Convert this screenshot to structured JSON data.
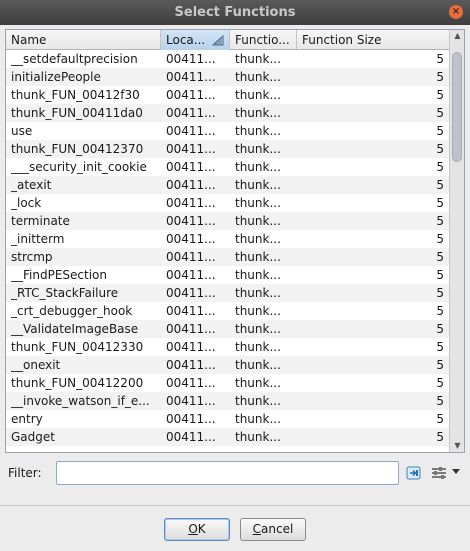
{
  "window": {
    "title": "Select Functions",
    "close_glyph": "×"
  },
  "table": {
    "columns": [
      {
        "label": "Name"
      },
      {
        "label": "Loca..."
      },
      {
        "label": "Functio..."
      },
      {
        "label": "Function Size"
      }
    ],
    "sorted_column": 1,
    "rows": [
      {
        "name": "__setdefaultprecision",
        "location": "00411...",
        "signature": "thunk...",
        "size": "5"
      },
      {
        "name": "initializePeople",
        "location": "00411...",
        "signature": "thunk...",
        "size": "5"
      },
      {
        "name": "thunk_FUN_00412f30",
        "location": "00411...",
        "signature": "thunk...",
        "size": "5"
      },
      {
        "name": "thunk_FUN_00411da0",
        "location": "00411...",
        "signature": "thunk...",
        "size": "5"
      },
      {
        "name": "use",
        "location": "00411...",
        "signature": "thunk...",
        "size": "5"
      },
      {
        "name": "thunk_FUN_00412370",
        "location": "00411...",
        "signature": "thunk...",
        "size": "5"
      },
      {
        "name": "___security_init_cookie",
        "location": "00411...",
        "signature": "thunk...",
        "size": "5"
      },
      {
        "name": "_atexit",
        "location": "00411...",
        "signature": "thunk...",
        "size": "5"
      },
      {
        "name": "_lock",
        "location": "00411...",
        "signature": "thunk...",
        "size": "5"
      },
      {
        "name": "terminate",
        "location": "00411...",
        "signature": "thunk...",
        "size": "5"
      },
      {
        "name": "_initterm",
        "location": "00411...",
        "signature": "thunk...",
        "size": "5"
      },
      {
        "name": "strcmp",
        "location": "00411...",
        "signature": "thunk...",
        "size": "5"
      },
      {
        "name": "__FindPESection",
        "location": "00411...",
        "signature": "thunk...",
        "size": "5"
      },
      {
        "name": "_RTC_StackFailure",
        "location": "00411...",
        "signature": "thunk...",
        "size": "5"
      },
      {
        "name": "_crt_debugger_hook",
        "location": "00411...",
        "signature": "thunk...",
        "size": "5"
      },
      {
        "name": "__ValidateImageBase",
        "location": "00411...",
        "signature": "thunk...",
        "size": "5"
      },
      {
        "name": "thunk_FUN_00412330",
        "location": "00411...",
        "signature": "thunk...",
        "size": "5"
      },
      {
        "name": "__onexit",
        "location": "00411...",
        "signature": "thunk...",
        "size": "5"
      },
      {
        "name": "thunk_FUN_00412200",
        "location": "00411...",
        "signature": "thunk...",
        "size": "5"
      },
      {
        "name": "__invoke_watson_if_e...",
        "location": "00411...",
        "signature": "thunk...",
        "size": "5"
      },
      {
        "name": "entry",
        "location": "00411...",
        "signature": "thunk...",
        "size": "5"
      },
      {
        "name": "Gadget",
        "location": "00411...",
        "signature": "thunk...",
        "size": "5"
      },
      {
        "name": "",
        "location": "",
        "signature": "",
        "size": ""
      }
    ]
  },
  "filter": {
    "label": "Filter:",
    "value": "",
    "placeholder": ""
  },
  "buttons": {
    "ok": {
      "mnemonic": "O",
      "rest": "K"
    },
    "cancel": {
      "mnemonic": "C",
      "rest": "ancel"
    }
  },
  "icons": {
    "close": "close-icon",
    "sort": "sort-ascending-icon",
    "filter": "filter-apply-icon",
    "options": "filter-options-icon",
    "dropdown": "chevron-down-icon"
  },
  "colors": {
    "titlebar": "#3e3e3e",
    "close_button": "#e96b3c",
    "sorted_header": "#b8d2ec",
    "row_alt": "#f2f2f2",
    "ok_border": "#5c8bc2"
  }
}
